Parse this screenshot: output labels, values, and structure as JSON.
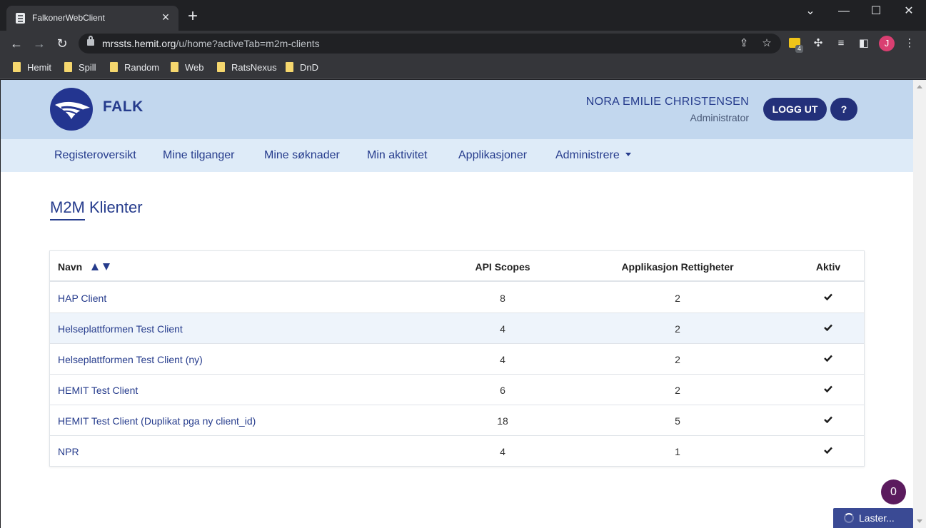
{
  "browser": {
    "tab_title": "FalkonerWebClient",
    "url_host": "mrssts.hemit.org",
    "url_path": "/u/home?activeTab=m2m-clients",
    "extension_badge": "4",
    "profile_initial": "J",
    "bookmarks": [
      "Hemit",
      "Spill",
      "Random",
      "Web",
      "RatsNexus",
      "DnD"
    ]
  },
  "header": {
    "brand": "FALK",
    "user_name": "NORA EMILIE CHRISTENSEN",
    "user_role": "Administrator",
    "logout_label": "LOGG UT",
    "help_label": "?"
  },
  "nav": {
    "items": [
      "Registeroversikt",
      "Mine tilganger",
      "Mine søknader",
      "Min aktivitet",
      "Applikasjoner",
      "Administrere"
    ]
  },
  "main": {
    "title": "M2M Klienter",
    "table": {
      "headers": {
        "name": "Navn",
        "api_scopes": "API Scopes",
        "app_rights": "Applikasjon Rettigheter",
        "active": "Aktiv"
      },
      "rows": [
        {
          "name": "HAP Client",
          "api_scopes": "8",
          "app_rights": "2",
          "active": true
        },
        {
          "name": "Helseplattformen Test Client",
          "api_scopes": "4",
          "app_rights": "2",
          "active": true
        },
        {
          "name": "Helseplattformen Test Client (ny)",
          "api_scopes": "4",
          "app_rights": "2",
          "active": true
        },
        {
          "name": "HEMIT Test Client",
          "api_scopes": "6",
          "app_rights": "2",
          "active": true
        },
        {
          "name": "HEMIT Test Client (Duplikat pga ny client_id)",
          "api_scopes": "18",
          "app_rights": "5",
          "active": true
        },
        {
          "name": "NPR",
          "api_scopes": "4",
          "app_rights": "1",
          "active": true
        }
      ]
    }
  },
  "widgets": {
    "notification_count": "0",
    "loading_label": "Laster..."
  },
  "colors": {
    "brand_blue": "#253b8c",
    "header_bg": "#c2d7ee",
    "nav_bg": "#deebf8",
    "button_bg": "#23307a",
    "row_highlight": "#eef4fb"
  }
}
